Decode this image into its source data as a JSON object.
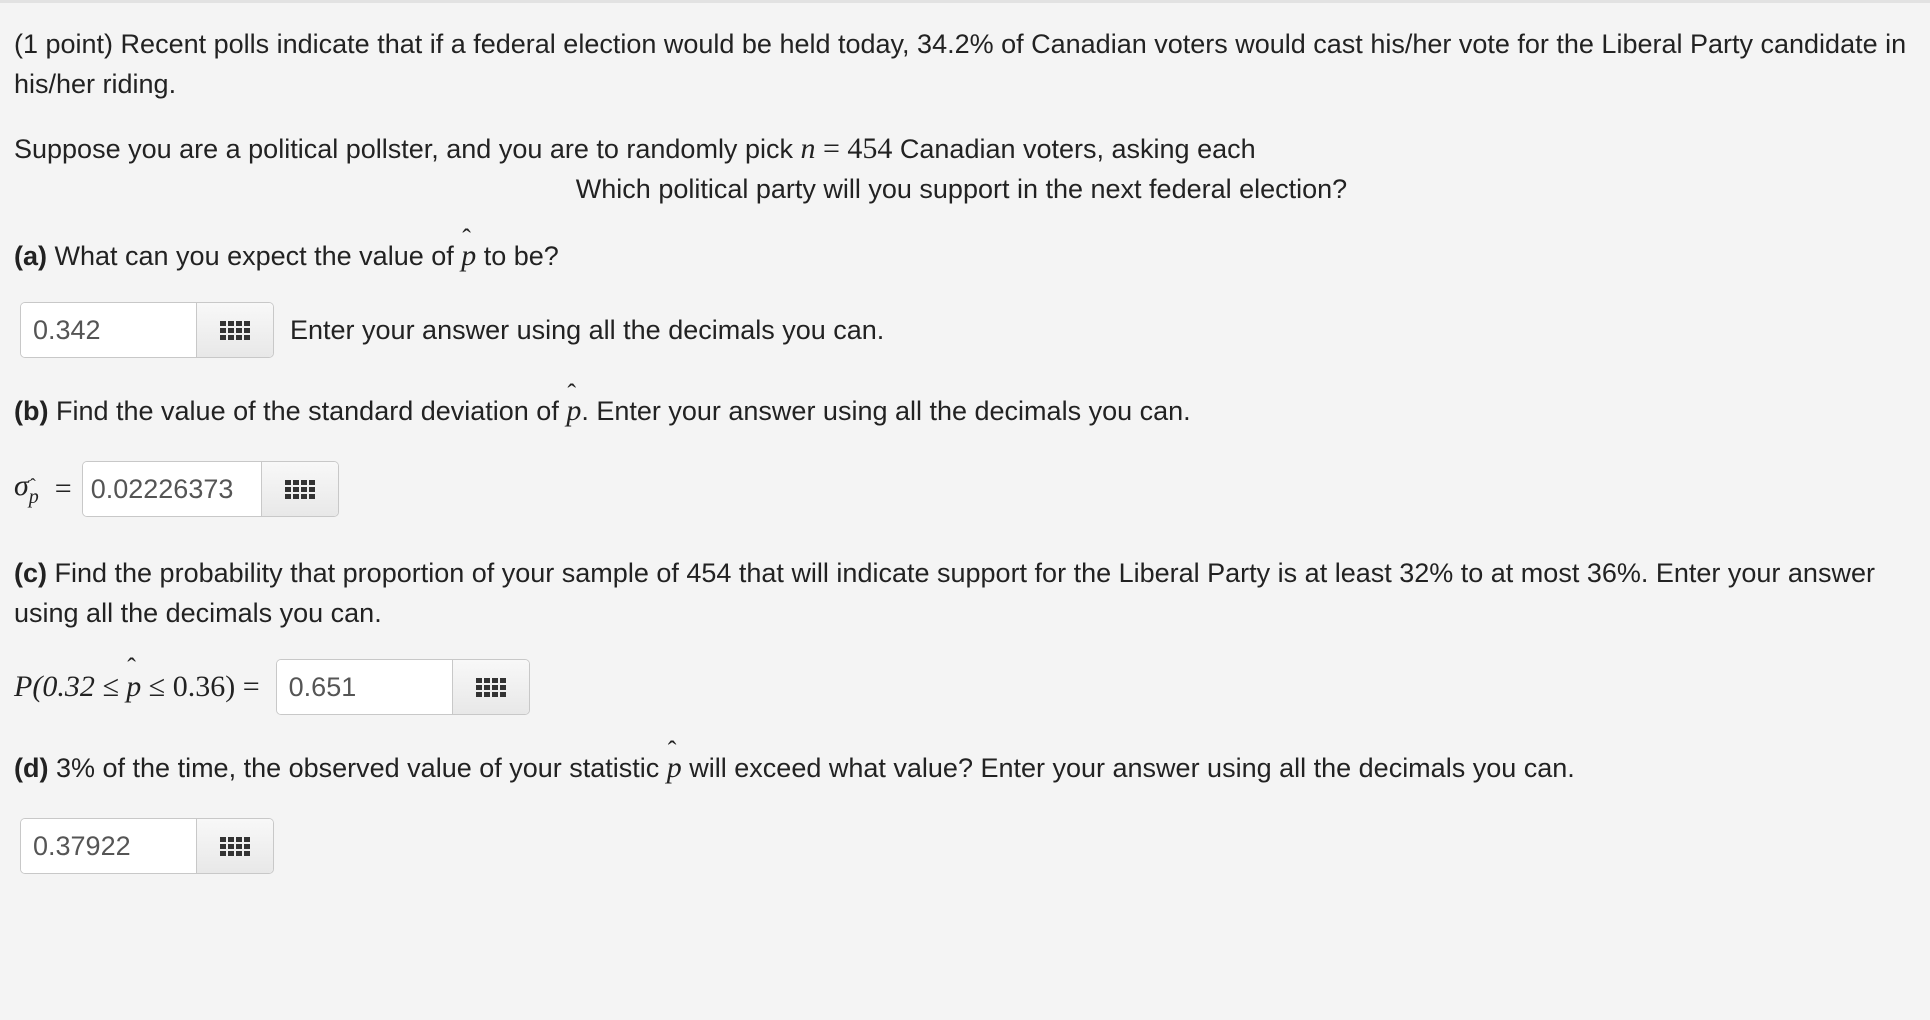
{
  "intro": {
    "line1": "(1 point) Recent polls indicate that if a federal election would be held today, 34.2% of Canadian voters would cast his/her vote for the Liberal Party candidate in his/her riding.",
    "line2_pre": "Suppose you are a political pollster, and you are to randomly pick ",
    "n_var": "n",
    "equals": " = ",
    "n_val": "454",
    "line2_post": " Canadian voters, asking each",
    "question": "Which political party will you support in the next federal election?"
  },
  "part_a": {
    "label": "(a)",
    "text_pre": " What can you expect the value of ",
    "text_post": " to be?",
    "answer": "0.342",
    "hint": "Enter your answer using all the decimals you can."
  },
  "part_b": {
    "label": "(b)",
    "text_pre": " Find the value of the standard deviation of ",
    "text_post": ". Enter your answer using all the decimals you can.",
    "lhs_sigma": "σ",
    "lhs_eq": "=",
    "answer": "0.02226373"
  },
  "part_c": {
    "label": "(c)",
    "text": " Find the probability that proportion of your sample of 454 that will indicate support for the Liberal Party is at least 32% to at most 36%. Enter your answer using all the decimals you can.",
    "lhs_pre": "P(0.32 ≤ ",
    "lhs_post": " ≤ 0.36) =",
    "answer": "0.651"
  },
  "part_d": {
    "label": "(d)",
    "text_pre": " 3% of the time, the observed value of your statistic ",
    "text_post": " will exceed what value? Enter your answer using all the decimals you can.",
    "answer": "0.37922"
  },
  "symbols": {
    "p": "p",
    "hat": "ˆ"
  },
  "icons": {
    "palette": "grid-icon"
  }
}
